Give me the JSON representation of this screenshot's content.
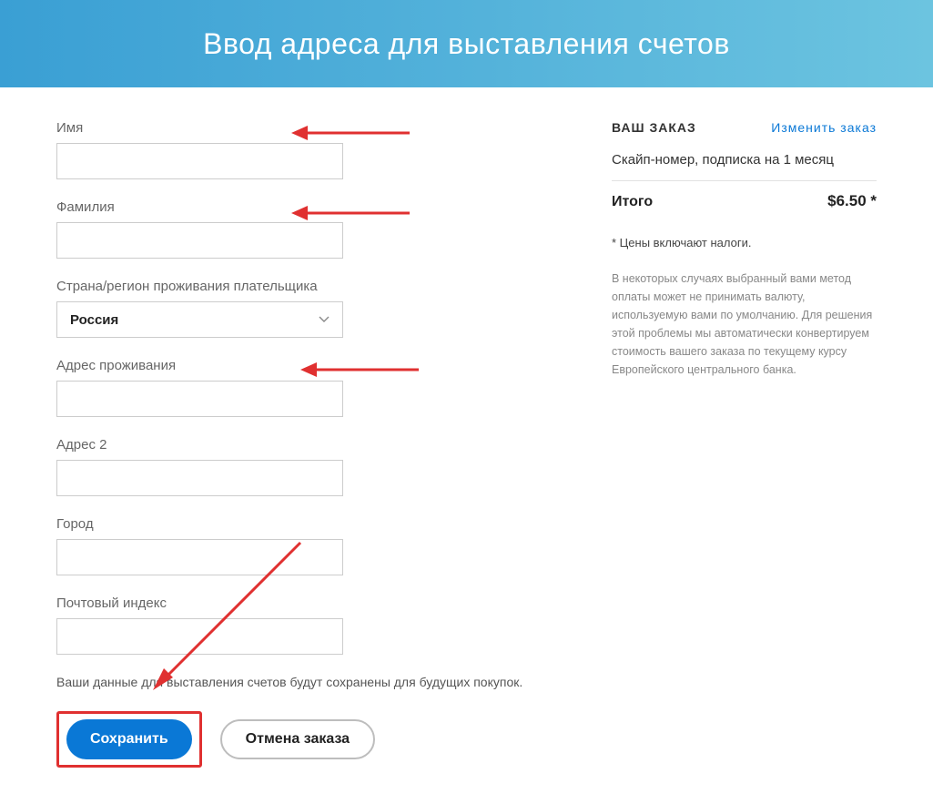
{
  "header": {
    "title": "Ввод адреса для выставления счетов"
  },
  "form": {
    "first_name": {
      "label": "Имя",
      "value": ""
    },
    "last_name": {
      "label": "Фамилия",
      "value": ""
    },
    "country": {
      "label": "Страна/регион проживания плательщика",
      "value": "Россия"
    },
    "address1": {
      "label": "Адрес проживания",
      "value": ""
    },
    "address2": {
      "label": "Адрес 2",
      "value": ""
    },
    "city": {
      "label": "Город",
      "value": ""
    },
    "postal": {
      "label": "Почтовый индекс",
      "value": ""
    },
    "save_note": "Ваши данные для выставления счетов будут сохранены для будущих покупок.",
    "save_button": "Сохранить",
    "cancel_button": "Отмена заказа"
  },
  "order": {
    "heading": "ВАШ ЗАКАЗ",
    "edit_link": "Изменить заказ",
    "item_line": "Скайп-номер, подписка на 1 месяц",
    "total_label": "Итого",
    "total_amount": "$6.50 *",
    "tax_note": "* Цены включают налоги.",
    "disclaimer": "В некоторых случаях выбранный вами метод оплаты может не принимать валюту, используемую вами по умолчанию. Для решения этой проблемы мы автоматически конвертируем стоимость вашего заказа по текущему курсу Европейского центрального банка."
  }
}
